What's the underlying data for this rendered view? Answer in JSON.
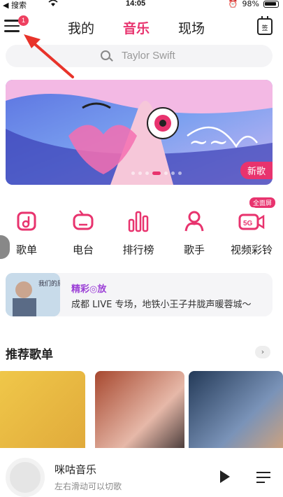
{
  "status_bar": {
    "carrier": "◀ 搜索",
    "time": "14:05",
    "battery": "98%"
  },
  "header": {
    "menu_badge": "1",
    "tabs": [
      {
        "label": "我的",
        "active": false
      },
      {
        "label": "音乐",
        "active": true
      },
      {
        "label": "现场",
        "active": false
      }
    ],
    "calendar_label": "签"
  },
  "search": {
    "placeholder": "Taylor Swift"
  },
  "banner": {
    "new_tag": "新歌",
    "slide_count": 7,
    "active_slide": 3
  },
  "quick_nav": [
    {
      "label": "歌单",
      "icon": "playlist-icon"
    },
    {
      "label": "电台",
      "icon": "radio-icon"
    },
    {
      "label": "排行榜",
      "icon": "chart-bars-icon"
    },
    {
      "label": "歌手",
      "icon": "singer-icon"
    },
    {
      "label": "视频彩铃",
      "icon": "5g-video-icon",
      "badge": "全面屏"
    }
  ],
  "live_card": {
    "title": "精彩◎放",
    "subtitle": "成都 LIVE 专场，地铁小王子井胧声暖蓉城～",
    "thumb_text": "我们的原点 LIVE"
  },
  "recommended": {
    "title": "推荐歌单",
    "more": "›"
  },
  "player": {
    "track": "咪咕音乐",
    "hint": "左右滑动可以切歌"
  },
  "colors": {
    "accent": "#e8336e",
    "arrow": "#e8332a"
  }
}
